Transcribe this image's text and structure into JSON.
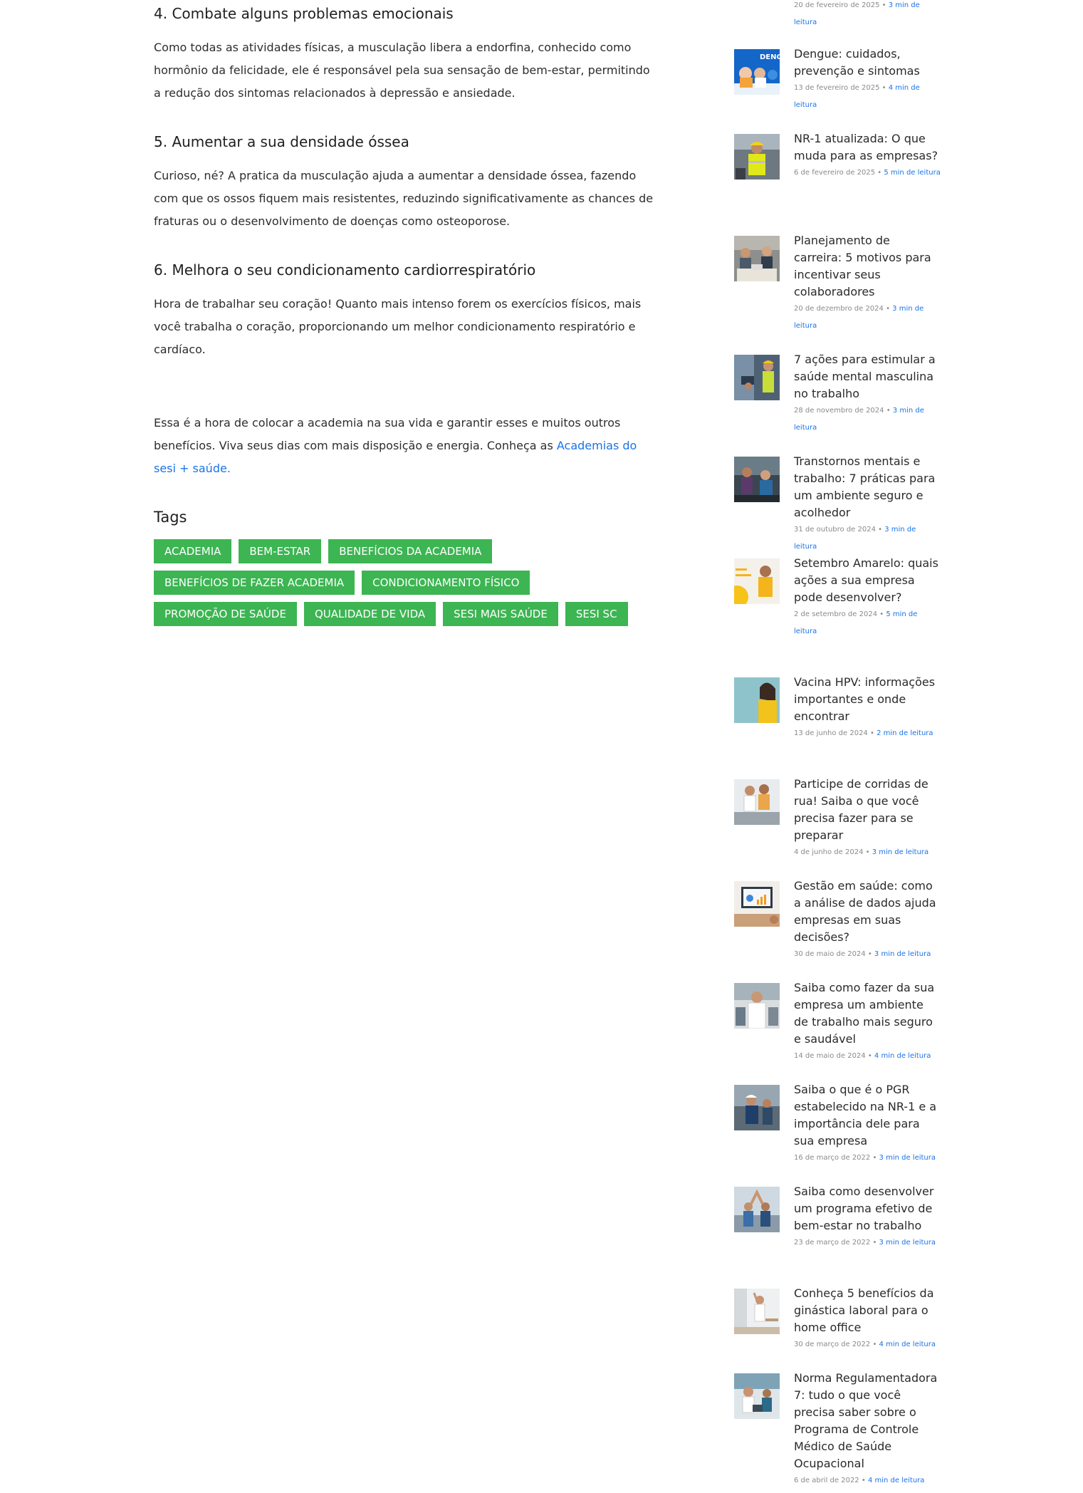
{
  "article": {
    "h4": "4. Combate alguns problemas emocionais",
    "p4": "Como todas as atividades físicas, a musculação libera a endorfina, conhecido como hormônio da felicidade, ele é responsável pela sua sensação de bem-estar, permitindo a redução dos sintomas relacionados à depressão e ansiedade.",
    "h5": "5. Aumentar a sua densidade óssea",
    "p5": "Curioso, né? A pratica da musculação ajuda a aumentar a densidade óssea, fazendo com que os ossos fiquem mais resistentes, reduzindo significativamente as chances de fraturas ou o desenvolvimento de doenças como osteoporose.",
    "h6": "6. Melhora o seu condicionamento cardiorrespiratório",
    "p6": "Hora de trabalhar seu coração! Quanto mais intenso forem os exercícios físicos, mais você trabalha o coração, proporcionando um melhor condicionamento respiratório e cardíaco.",
    "conclusion": "Essa é a hora de colocar a academia na sua vida e garantir esses e muitos outros benefícios. Viva seus dias com mais disposição e energia. Conheça as ",
    "conclusion_link": "Academias do sesi + saúde.",
    "tags_title": "Tags",
    "tags": [
      [
        "ACADEMIA",
        "BEM-ESTAR",
        "BENEFÍCIOS DA ACADEMIA"
      ],
      [
        "BENEFÍCIOS DE FAZER ACADEMIA",
        "CONDICIONAMENTO FÍSICO"
      ],
      [
        "PROMOÇÃO DE SAÚDE",
        "QUALIDADE DE VIDA",
        "SESI MAIS SAÚDE",
        "SESI SC"
      ]
    ]
  },
  "sidebar": {
    "top_meta": {
      "date": "20 de fevereiro de 2025",
      "sep": " • ",
      "read": "3 min de leitura"
    },
    "posts": [
      {
        "title": "Dengue: cuidados, prevenção e sintomas",
        "date": "13 de fevereiro de 2025",
        "sep": " • ",
        "read": "4 min de leitura",
        "thumb_text": "DENG"
      },
      {
        "title": "NR-1 atualizada: O que muda para as empresas?",
        "date": "6 de fevereiro de 2025",
        "sep": " • ",
        "read": "5 min de leitura"
      },
      {
        "title": "Planejamento de carreira: 5 motivos para incentivar seus colaboradores",
        "date": "20 de dezembro de 2024",
        "sep": " • ",
        "read": "3 min de leitura"
      },
      {
        "title": "7 ações para estimular a saúde mental masculina no trabalho",
        "date": "28 de novembro de 2024",
        "sep": " • ",
        "read": "3 min de leitura"
      },
      {
        "title": "Transtornos mentais e trabalho: 7 práticas para um ambiente seguro e acolhedor",
        "date": "31 de outubro de 2024",
        "sep": " • ",
        "read": "3 min de leitura"
      },
      {
        "title": "Setembro Amarelo: quais ações a sua empresa pode desenvolver?",
        "date": "2 de setembro de 2024",
        "sep": " • ",
        "read": "5 min de leitura"
      },
      {
        "title": "Vacina HPV: informações importantes e onde encontrar",
        "date": "13 de junho de 2024",
        "sep": " • ",
        "read": "2 min de leitura"
      },
      {
        "title": "Participe de corridas de rua! Saiba o que você precisa fazer para se preparar",
        "date": "4 de junho de 2024",
        "sep": " • ",
        "read": "3 min de leitura"
      },
      {
        "title": "Gestão em saúde: como a análise de dados ajuda empresas em suas decisões?",
        "date": "30 de maio de 2024",
        "sep": " • ",
        "read": "3 min de leitura"
      },
      {
        "title": "Saiba como fazer da sua empresa um ambiente de trabalho mais seguro e saudável",
        "date": "14 de maio de 2024",
        "sep": " • ",
        "read": "4 min de leitura"
      },
      {
        "title": "Saiba o que é o PGR estabelecido na NR-1 e a importância dele para sua empresa",
        "date": "16 de março de 2022",
        "sep": " • ",
        "read": "3 min de leitura"
      },
      {
        "title": "Saiba como desenvolver um programa efetivo de bem-estar no trabalho",
        "date": "23 de março de 2022",
        "sep": " • ",
        "read": "3 min de leitura"
      },
      {
        "title": "Conheça 5 benefícios da ginástica laboral para o home office",
        "date": "30 de março de 2022",
        "sep": " • ",
        "read": "4 min de leitura"
      },
      {
        "title": "Norma Regulamentadora 7: tudo o que você precisa saber sobre o Programa de Controle Médico de Saúde Ocupacional",
        "date": "6 de abril de 2022",
        "sep": " • ",
        "read": "4 min de leitura"
      }
    ]
  },
  "colors": {
    "tag_bg": "#3cb552",
    "link": "#1a73e8",
    "text": "#2d2d2d",
    "meta": "#8a8a8a"
  }
}
